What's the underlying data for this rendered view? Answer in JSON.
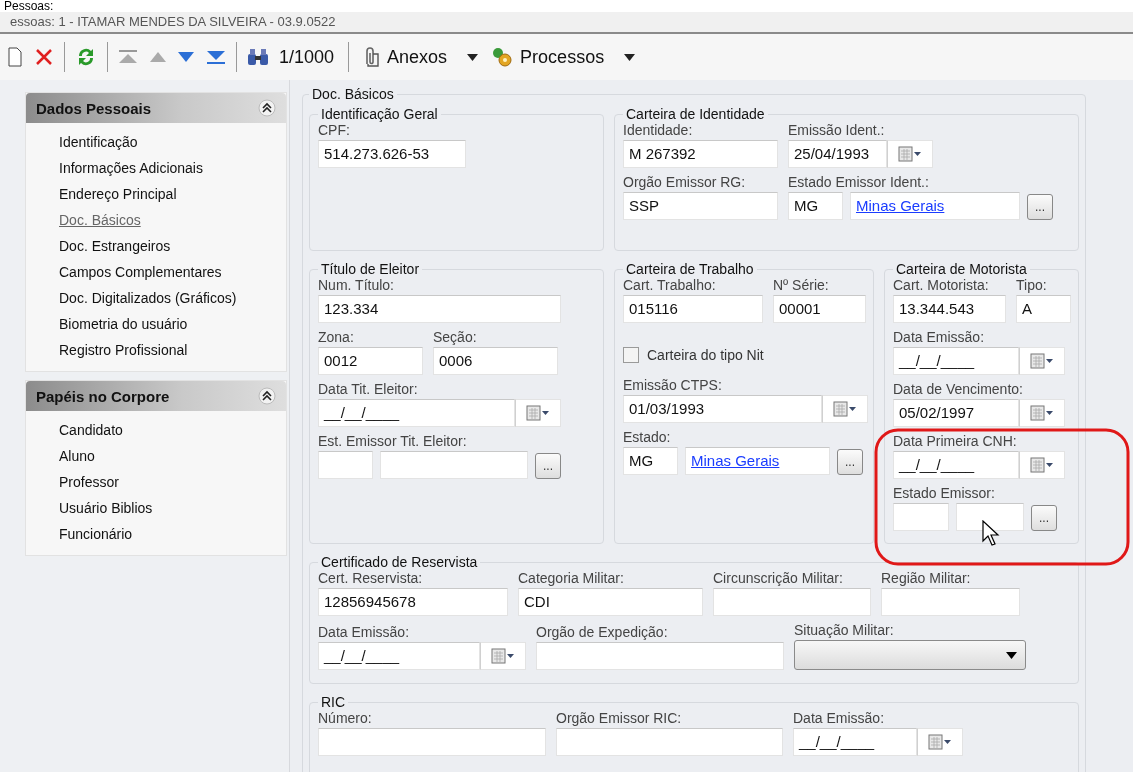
{
  "header": {
    "caption": "Pessoas:",
    "title": "essoas: 1 - ITAMAR MENDES DA SILVEIRA - 03.9.0522"
  },
  "toolbar": {
    "record_counter": "1/1000",
    "menus": [
      {
        "kind": "attach",
        "label": "Anexos"
      },
      {
        "kind": "process",
        "label": "Processos"
      }
    ]
  },
  "sidebar": {
    "panels": [
      {
        "title": "Dados Pessoais",
        "expanded": true,
        "items": [
          {
            "label": "Identificação",
            "selected": false
          },
          {
            "label": "Informações Adicionais",
            "selected": false
          },
          {
            "label": "Endereço Principal",
            "selected": false
          },
          {
            "label": "Doc. Básicos",
            "selected": true
          },
          {
            "label": "Doc. Estrangeiros",
            "selected": false
          },
          {
            "label": "Campos Complementares",
            "selected": false
          },
          {
            "label": "Doc. Digitalizados (Gráficos)",
            "selected": false
          },
          {
            "label": "Biometria do usuário",
            "selected": false
          },
          {
            "label": "Registro Profissional",
            "selected": false
          }
        ]
      },
      {
        "title": "Papéis no Corpore",
        "expanded": true,
        "items": [
          {
            "label": "Candidato",
            "selected": false
          },
          {
            "label": "Aluno",
            "selected": false
          },
          {
            "label": "Professor",
            "selected": false
          },
          {
            "label": "Usuário Biblios",
            "selected": false
          },
          {
            "label": "Funcionário",
            "selected": false
          }
        ]
      }
    ]
  },
  "form": {
    "title": "Doc. Básicos",
    "groups": [
      {
        "title": "Identificação Geral",
        "rows": [
          [
            {
              "kind": "text",
              "label": "CPF:",
              "value": "514.273.626-53"
            }
          ]
        ]
      },
      {
        "title": "Carteira de Identidade",
        "rows": [
          [
            {
              "kind": "text",
              "label": "Identidade:",
              "value": "M 267392"
            },
            {
              "kind": "date",
              "label": "Emissão Ident.:",
              "value": "25/04/1993"
            }
          ],
          [
            {
              "kind": "text",
              "label": "Orgão Emissor RG:",
              "value": "SSP"
            },
            {
              "kind": "lookup",
              "label": "Estado Emissor Ident.:",
              "code": "MG",
              "name": "Minas Gerais",
              "button": "..."
            }
          ]
        ]
      },
      {
        "title": "Título de Eleitor",
        "rows": [
          [
            {
              "kind": "text",
              "label": "Num. Título:",
              "value": "123.334"
            }
          ],
          [
            {
              "kind": "text",
              "label": "Zona:",
              "value": "0012"
            },
            {
              "kind": "text",
              "label": "Seção:",
              "value": "0006"
            }
          ],
          [
            {
              "kind": "date",
              "label": "Data Tit. Eleitor:",
              "value": "__/__/____"
            }
          ],
          [
            {
              "kind": "lookup",
              "label": "Est. Emissor Tit. Eleitor:",
              "button": "..."
            }
          ]
        ]
      },
      {
        "title": "Carteira de Trabalho",
        "rows": [
          [
            {
              "kind": "text",
              "label": "Cart. Trabalho:",
              "value": "015116"
            },
            {
              "kind": "text",
              "label": "Nº Série:",
              "value": "00001"
            }
          ],
          [
            {
              "kind": "checkbox",
              "label": "Carteira do tipo Nit",
              "checked": false
            }
          ],
          [
            {
              "kind": "date",
              "label": "Emissão CTPS:",
              "value": "01/03/1993"
            }
          ],
          [
            {
              "kind": "lookup",
              "label": "Estado:",
              "code": "MG",
              "name": "Minas Gerais",
              "button": "..."
            }
          ]
        ]
      },
      {
        "title": "Carteira de Motorista",
        "rows": [
          [
            {
              "kind": "text",
              "label": "Cart. Motorista:",
              "value": "13.344.543"
            },
            {
              "kind": "text",
              "label": "Tipo:",
              "value": "A"
            }
          ],
          [
            {
              "kind": "date",
              "label": "Data Emissão:",
              "value": "__/__/____"
            }
          ],
          [
            {
              "kind": "date",
              "label": "Data de Vencimento:",
              "value": "05/02/1997"
            }
          ],
          [
            {
              "kind": "date",
              "label": "Data Primeira CNH:",
              "value": "__/__/____"
            }
          ],
          [
            {
              "kind": "lookup",
              "label": "Estado Emissor:",
              "button": "..."
            }
          ]
        ]
      },
      {
        "title": "Certificado de Reservista",
        "rows": [
          [
            {
              "kind": "text",
              "label": "Cert. Reservista:",
              "value": "12856945678"
            },
            {
              "kind": "text",
              "label": "Categoria Militar:",
              "value": "CDI"
            },
            {
              "kind": "text",
              "label": "Circunscrição Militar:"
            },
            {
              "kind": "text",
              "label": "Região Militar:"
            }
          ],
          [
            {
              "kind": "date",
              "label": "Data Emissão:",
              "value": "__/__/____"
            },
            {
              "kind": "text",
              "label": "Orgão de Expedição:"
            },
            {
              "kind": "select",
              "label": "Situação Militar:"
            }
          ]
        ]
      },
      {
        "title": "RIC",
        "rows": [
          [
            {
              "kind": "text",
              "label": "Número:"
            },
            {
              "kind": "text",
              "label": "Orgão Emissor RIC:"
            },
            {
              "kind": "date",
              "label": "Data Emissão:",
              "value": "__/__/____"
            }
          ]
        ]
      }
    ]
  }
}
